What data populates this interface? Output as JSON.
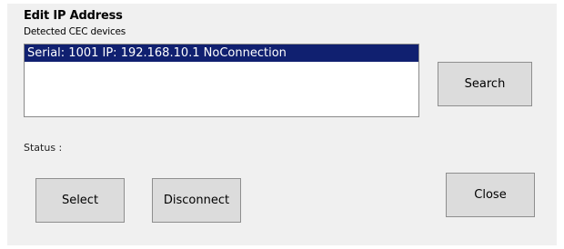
{
  "dialog": {
    "title": "Edit IP Address",
    "subtitle": "Detected CEC devices"
  },
  "device_list": {
    "items": [
      {
        "label": "Serial: 1001 IP: 192.168.10.1 NoConnection",
        "selected": true
      }
    ],
    "selected_color": "#102070"
  },
  "status": {
    "label": "Status :"
  },
  "buttons": {
    "search": "Search",
    "select": "Select",
    "disconnect": "Disconnect",
    "close": "Close"
  }
}
